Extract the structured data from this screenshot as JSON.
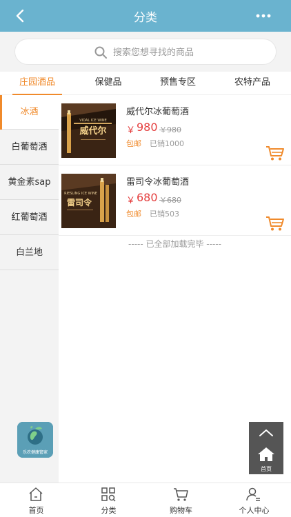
{
  "header": {
    "title": "分类",
    "back_icon": "chevron-left-icon",
    "more_icon": "more-dots-icon",
    "color": "#6ab3cf"
  },
  "search": {
    "placeholder": "搜索您想寻找的商品",
    "value": ""
  },
  "tabs": [
    {
      "label": "庄园酒品",
      "active": true
    },
    {
      "label": "保健品",
      "active": false
    },
    {
      "label": "预售专区",
      "active": false
    },
    {
      "label": "农特产品",
      "active": false
    }
  ],
  "sidebar": {
    "items": [
      {
        "label": "冰酒",
        "active": true
      },
      {
        "label": "白葡萄酒",
        "active": false
      },
      {
        "label": "黄金素sap",
        "active": false
      },
      {
        "label": "红葡萄酒",
        "active": false
      },
      {
        "label": "白兰地",
        "active": false
      }
    ]
  },
  "products": [
    {
      "name": "威代尔冰葡萄酒",
      "currency": "￥",
      "price": "980",
      "old_price": "￥980",
      "shipping": "包邮",
      "sold": "已销1000",
      "thumb_text": "威代尔",
      "thumb_subtext": "VIDAL ICE WINE"
    },
    {
      "name": "雷司令冰葡萄酒",
      "currency": "￥",
      "price": "680",
      "old_price": "￥680",
      "shipping": "包邮",
      "sold": "已销503",
      "thumb_text": "雷司令",
      "thumb_subtext": "RIESLING ICE WINE"
    }
  ],
  "list_end_text": "----- 已全部加载完毕 -----",
  "logo": {
    "text": "乐农健康管家"
  },
  "float_button": {
    "home_label": "首页"
  },
  "bottom_nav": [
    {
      "label": "首页",
      "icon": "home-icon"
    },
    {
      "label": "分类",
      "icon": "category-grid-icon"
    },
    {
      "label": "购物车",
      "icon": "cart-icon"
    },
    {
      "label": "个人中心",
      "icon": "user-icon"
    }
  ],
  "colors": {
    "accent": "#f08a2b",
    "price": "#e43d3d",
    "header": "#6ab3cf"
  }
}
